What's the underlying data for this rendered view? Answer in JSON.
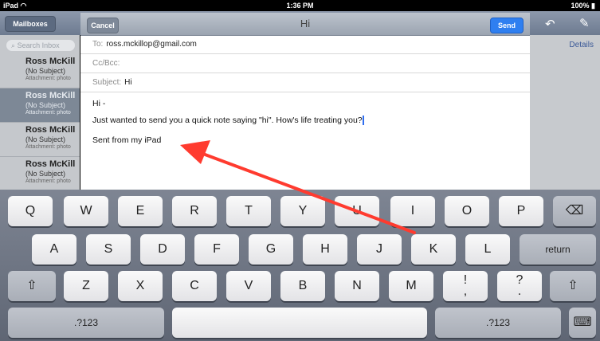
{
  "status_bar": {
    "device": "iPad",
    "wifi_icon": "wifi-icon",
    "time": "1:36 PM",
    "battery": "100%",
    "battery_icon": "battery-icon"
  },
  "mail_nav": {
    "back_label": "Mailboxes",
    "details_label": "Details",
    "reply_icon": "reply-icon",
    "compose_icon": "compose-icon"
  },
  "inbox": {
    "search_placeholder": "Search Inbox",
    "items": [
      {
        "name": "Ross McKill",
        "subject": "(No Subject)",
        "attachment": "Attachment: photo"
      },
      {
        "name": "Ross McKill",
        "subject": "(No Subject)",
        "attachment": "Attachment: photo"
      },
      {
        "name": "Ross McKill",
        "subject": "(No Subject)",
        "attachment": "Attachment: photo"
      },
      {
        "name": "Ross McKill",
        "subject": "(No Subject)",
        "attachment": "Attachment: photo"
      }
    ]
  },
  "compose": {
    "cancel_label": "Cancel",
    "title": "Hi",
    "send_label": "Send",
    "to_label": "To:",
    "to_value": "ross.mckillop@gmail.com",
    "ccbcc_label": "Cc/Bcc:",
    "subject_label": "Subject:",
    "subject_value": "Hi",
    "body_greeting": "Hi -",
    "body_message": "Just wanted to send you a quick note saying \"hi\". How's life treating you?",
    "signature": "Sent from my iPad"
  },
  "keyboard": {
    "row1": [
      "Q",
      "W",
      "E",
      "R",
      "T",
      "Y",
      "U",
      "I",
      "O",
      "P"
    ],
    "row2": [
      "A",
      "S",
      "D",
      "F",
      "G",
      "H",
      "J",
      "K",
      "L"
    ],
    "row3": [
      "Z",
      "X",
      "C",
      "V",
      "B",
      "N",
      "M"
    ],
    "return_label": "return",
    "numbers_label": ".?123",
    "excl_top": "!",
    "excl_bottom": ",",
    "question_top": "?",
    "question_bottom": ".",
    "backspace_icon": "backspace-icon",
    "shift_icon": "shift-icon",
    "hide_keyboard_icon": "keyboard-hide-icon"
  },
  "annotation": {
    "arrow_color": "#ff3b2f"
  }
}
